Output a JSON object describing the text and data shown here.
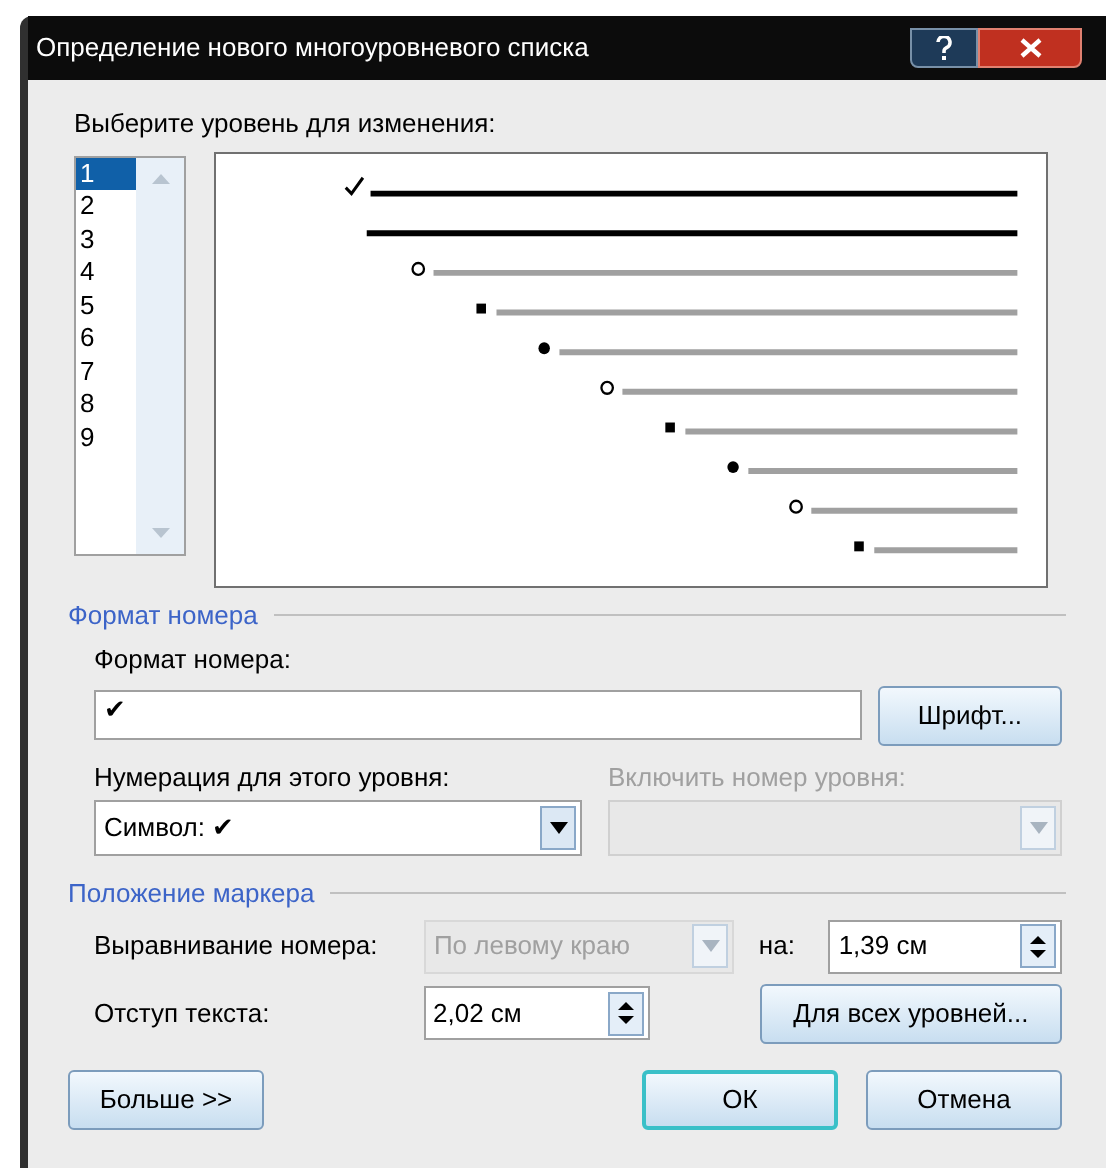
{
  "window": {
    "title": "Определение нового многоуровневого списка"
  },
  "level_label": "Выберите уровень для изменения:",
  "levels": [
    {
      "label": "1",
      "selected": true,
      "kind": "check"
    },
    {
      "label": "2",
      "selected": false,
      "kind": "circle"
    },
    {
      "label": "3",
      "selected": false,
      "kind": "square"
    },
    {
      "label": "4",
      "selected": false,
      "kind": "dot"
    },
    {
      "label": "5",
      "selected": false,
      "kind": "circle"
    },
    {
      "label": "6",
      "selected": false,
      "kind": "square"
    },
    {
      "label": "7",
      "selected": false,
      "kind": "dot"
    },
    {
      "label": "8",
      "selected": false,
      "kind": "circle"
    },
    {
      "label": "9",
      "selected": false,
      "kind": "square"
    }
  ],
  "number_format": {
    "heading": "Формат номера",
    "label": "Формат номера:",
    "value": "✔",
    "font_button": "Шрифт...",
    "style_label": "Нумерация для этого уровня:",
    "style_value": "Символ: ✔",
    "include_label": "Включить номер уровня:",
    "include_disabled": true
  },
  "position": {
    "heading": "Положение маркера",
    "align_label": "Выравнивание номера:",
    "align_value": "По левому краю",
    "align_disabled": true,
    "at_label": "на:",
    "at_value": "1,39 см",
    "indent_label": "Отступ текста:",
    "indent_value": "2,02 см",
    "all_levels_button": "Для всех уровней..."
  },
  "buttons": [
    {
      "label": "Больше >>",
      "default": false
    },
    {
      "label": "ОК",
      "default": true
    },
    {
      "label": "Отмена",
      "default": false
    }
  ]
}
